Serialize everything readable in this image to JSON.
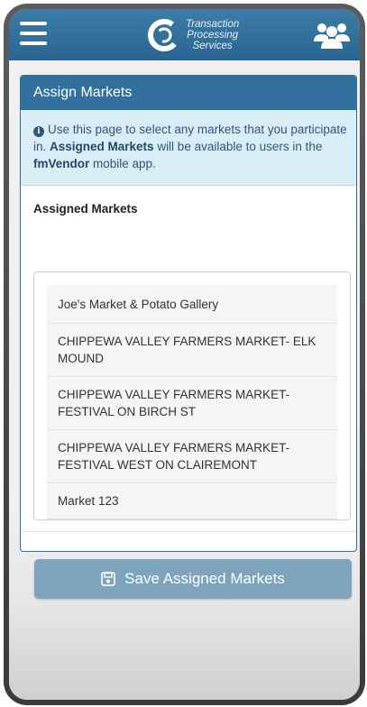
{
  "header": {
    "logo_lines": [
      "Transaction",
      "Processing",
      "Services"
    ],
    "menu_icon": "hamburger-menu-icon",
    "users_icon": "users-icon"
  },
  "card": {
    "title": "Assign Markets",
    "info": {
      "part1": "Use this page to select any markets that you participate in. ",
      "bold1": "Assigned Markets",
      "part2": " will be available to users in the ",
      "bold2": "fmVendor",
      "part3": " mobile app."
    },
    "section_label": "Assigned Markets",
    "markets": [
      "Joe's Market & Potato Gallery",
      "CHIPPEWA VALLEY FARMERS MARKET- ELK MOUND",
      "CHIPPEWA VALLEY FARMERS MARKET- FESTIVAL ON BIRCH ST",
      "CHIPPEWA VALLEY FARMERS MARKET- FESTIVAL WEST ON CLAIREMONT",
      "Market 123"
    ],
    "save_label": "Save Assigned Markets",
    "save_icon": "floppy-disk-icon"
  },
  "colors": {
    "header": "#2f6e9b",
    "card_header": "#32719e",
    "info_bg": "#d9edf7",
    "save_button": "#7da3bd"
  }
}
